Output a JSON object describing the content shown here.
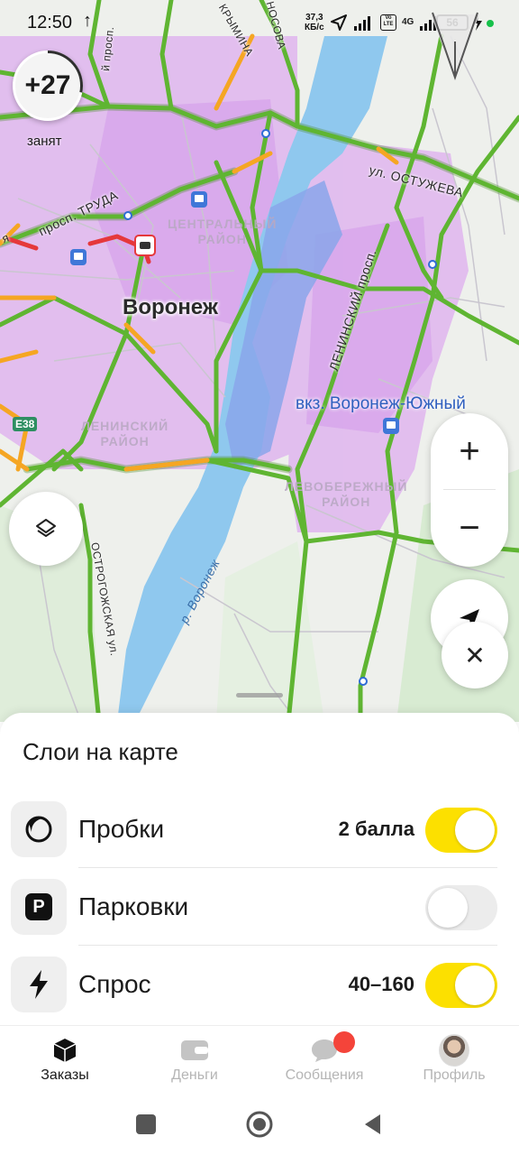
{
  "status_bar": {
    "time": "12:50",
    "upload_indicator": "↑",
    "net_speed_value": "37,3",
    "net_speed_unit": "КБ/с",
    "network_badge": "4G",
    "volte_badge": "Vo LTE",
    "battery": "56",
    "icons": [
      "arrow-up-icon",
      "location-arrow-icon",
      "signal-icon",
      "volte-icon",
      "signal-icon",
      "battery-icon",
      "charging-icon",
      "dot-icon"
    ]
  },
  "map": {
    "temperature_badge": "+27",
    "driver_status": "занят",
    "city_label": "Воронеж",
    "station_label": "вкз. Воронеж-Южный",
    "districts": {
      "central_line1": "ЦЕНТРАЛЬНЫЙ",
      "central_line2": "РАЙОН",
      "leninsky_line1": "ЛЕНИНСКИЙ",
      "leninsky_line2": "РАЙОН",
      "left_bank_line1": "ЛЕВОБЕРЕЖНЫЙ",
      "left_bank_line2": "РАЙОН"
    },
    "streets": {
      "ostuzheva": "ул. ОСТУЖЕВА",
      "trudа": "просп. ТРУДА",
      "leninsky": "ЛЕНИНСКИЙ просп.",
      "ostrogozhskaya": "ОСТРОГОЖСКАЯ ул.",
      "nosova": "НОСОВА",
      "krymina": "КРЫМИНА",
      "prosp_top": "й просп.",
      "ya": "я"
    },
    "river_label": "р. Воронеж",
    "highway_badge": "E38",
    "zoom_in": "+",
    "zoom_out": "−",
    "close": "✕"
  },
  "layers_sheet": {
    "title": "Слои на карте",
    "layers": [
      {
        "label": "Пробки",
        "value": "2 балла",
        "enabled": true,
        "icon": "traffic-icon"
      },
      {
        "label": "Парковки",
        "value": "",
        "enabled": false,
        "icon": "parking-icon"
      },
      {
        "label": "Спрос",
        "value": "40–160",
        "enabled": true,
        "icon": "lightning-icon"
      }
    ],
    "parking_glyph": "P"
  },
  "tab_bar": {
    "tabs": [
      {
        "label": "Заказы",
        "icon": "cube-icon",
        "active": true
      },
      {
        "label": "Деньги",
        "icon": "wallet-icon",
        "active": false
      },
      {
        "label": "Сообщения",
        "icon": "chat-icon",
        "active": false,
        "badge": true
      },
      {
        "label": "Профиль",
        "icon": "avatar",
        "active": false
      }
    ]
  },
  "colors": {
    "accent_yellow": "#fce000",
    "traffic_green": "#5fb532",
    "traffic_orange": "#f5a623",
    "traffic_red": "#e5383b",
    "demand_purple": "#d896f0",
    "water_blue": "#8fc8ee",
    "badge_red": "#f4443a"
  }
}
